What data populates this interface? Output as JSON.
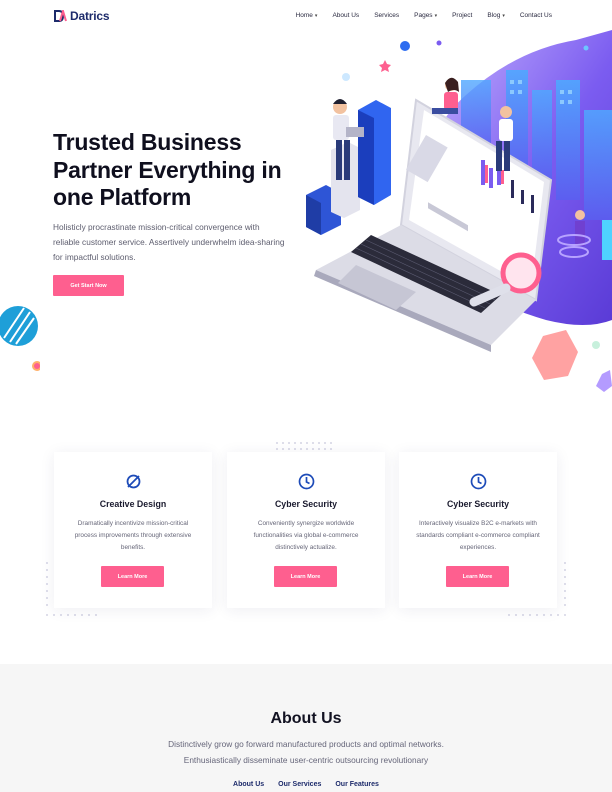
{
  "brand": {
    "name": "Datrics"
  },
  "nav": [
    {
      "label": "Home",
      "dropdown": true
    },
    {
      "label": "About Us",
      "dropdown": false
    },
    {
      "label": "Services",
      "dropdown": false
    },
    {
      "label": "Pages",
      "dropdown": true
    },
    {
      "label": "Project",
      "dropdown": false
    },
    {
      "label": "Blog",
      "dropdown": true
    },
    {
      "label": "Contact Us",
      "dropdown": false
    }
  ],
  "hero": {
    "title": "Trusted Business Partner Everything in one Platform",
    "description": "Holisticly procrastinate mission-critical convergence with reliable customer service. Assertively underwhelm idea-sharing for impactful solutions.",
    "button": "Get Start Now"
  },
  "features": [
    {
      "icon": "design-icon",
      "title": "Creative Design",
      "description": "Dramatically incentivize mission-critical process improvements through extensive benefits.",
      "button": "Learn More"
    },
    {
      "icon": "clock-icon",
      "title": "Cyber Security",
      "description": "Conveniently synergize worldwide functionalities via global e-commerce distinctively actualize.",
      "button": "Learn More"
    },
    {
      "icon": "clock-icon",
      "title": "Cyber Security",
      "description": "Interactively visualize B2C e-markets with standards compliant e-commerce compliant experiences.",
      "button": "Learn More"
    }
  ],
  "about": {
    "title": "About Us",
    "text": "Distinctively grow go forward manufactured products and optimal networks. Enthusiastically disseminate user-centric outsourcing revolutionary",
    "tabs": [
      "About Us",
      "Our Services",
      "Our Features"
    ]
  },
  "colors": {
    "accent": "#fe5f8f",
    "brand": "#1d2b6b",
    "purple": "#7b5cf0"
  }
}
